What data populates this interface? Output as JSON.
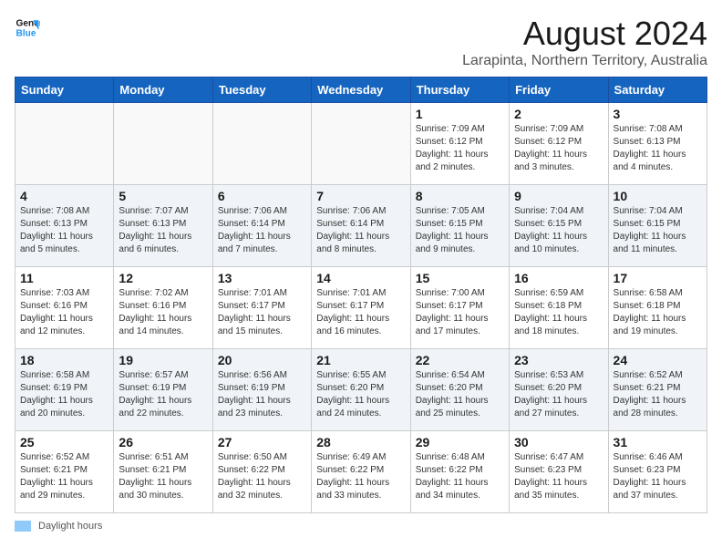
{
  "header": {
    "logo_line1": "General",
    "logo_line2": "Blue",
    "title": "August 2024",
    "subtitle": "Larapinta, Northern Territory, Australia"
  },
  "day_headers": [
    "Sunday",
    "Monday",
    "Tuesday",
    "Wednesday",
    "Thursday",
    "Friday",
    "Saturday"
  ],
  "weeks": [
    [
      {
        "day": "",
        "detail": ""
      },
      {
        "day": "",
        "detail": ""
      },
      {
        "day": "",
        "detail": ""
      },
      {
        "day": "",
        "detail": ""
      },
      {
        "day": "1",
        "detail": "Sunrise: 7:09 AM\nSunset: 6:12 PM\nDaylight: 11 hours\nand 2 minutes."
      },
      {
        "day": "2",
        "detail": "Sunrise: 7:09 AM\nSunset: 6:12 PM\nDaylight: 11 hours\nand 3 minutes."
      },
      {
        "day": "3",
        "detail": "Sunrise: 7:08 AM\nSunset: 6:13 PM\nDaylight: 11 hours\nand 4 minutes."
      }
    ],
    [
      {
        "day": "4",
        "detail": "Sunrise: 7:08 AM\nSunset: 6:13 PM\nDaylight: 11 hours\nand 5 minutes."
      },
      {
        "day": "5",
        "detail": "Sunrise: 7:07 AM\nSunset: 6:13 PM\nDaylight: 11 hours\nand 6 minutes."
      },
      {
        "day": "6",
        "detail": "Sunrise: 7:06 AM\nSunset: 6:14 PM\nDaylight: 11 hours\nand 7 minutes."
      },
      {
        "day": "7",
        "detail": "Sunrise: 7:06 AM\nSunset: 6:14 PM\nDaylight: 11 hours\nand 8 minutes."
      },
      {
        "day": "8",
        "detail": "Sunrise: 7:05 AM\nSunset: 6:15 PM\nDaylight: 11 hours\nand 9 minutes."
      },
      {
        "day": "9",
        "detail": "Sunrise: 7:04 AM\nSunset: 6:15 PM\nDaylight: 11 hours\nand 10 minutes."
      },
      {
        "day": "10",
        "detail": "Sunrise: 7:04 AM\nSunset: 6:15 PM\nDaylight: 11 hours\nand 11 minutes."
      }
    ],
    [
      {
        "day": "11",
        "detail": "Sunrise: 7:03 AM\nSunset: 6:16 PM\nDaylight: 11 hours\nand 12 minutes."
      },
      {
        "day": "12",
        "detail": "Sunrise: 7:02 AM\nSunset: 6:16 PM\nDaylight: 11 hours\nand 14 minutes."
      },
      {
        "day": "13",
        "detail": "Sunrise: 7:01 AM\nSunset: 6:17 PM\nDaylight: 11 hours\nand 15 minutes."
      },
      {
        "day": "14",
        "detail": "Sunrise: 7:01 AM\nSunset: 6:17 PM\nDaylight: 11 hours\nand 16 minutes."
      },
      {
        "day": "15",
        "detail": "Sunrise: 7:00 AM\nSunset: 6:17 PM\nDaylight: 11 hours\nand 17 minutes."
      },
      {
        "day": "16",
        "detail": "Sunrise: 6:59 AM\nSunset: 6:18 PM\nDaylight: 11 hours\nand 18 minutes."
      },
      {
        "day": "17",
        "detail": "Sunrise: 6:58 AM\nSunset: 6:18 PM\nDaylight: 11 hours\nand 19 minutes."
      }
    ],
    [
      {
        "day": "18",
        "detail": "Sunrise: 6:58 AM\nSunset: 6:19 PM\nDaylight: 11 hours\nand 20 minutes."
      },
      {
        "day": "19",
        "detail": "Sunrise: 6:57 AM\nSunset: 6:19 PM\nDaylight: 11 hours\nand 22 minutes."
      },
      {
        "day": "20",
        "detail": "Sunrise: 6:56 AM\nSunset: 6:19 PM\nDaylight: 11 hours\nand 23 minutes."
      },
      {
        "day": "21",
        "detail": "Sunrise: 6:55 AM\nSunset: 6:20 PM\nDaylight: 11 hours\nand 24 minutes."
      },
      {
        "day": "22",
        "detail": "Sunrise: 6:54 AM\nSunset: 6:20 PM\nDaylight: 11 hours\nand 25 minutes."
      },
      {
        "day": "23",
        "detail": "Sunrise: 6:53 AM\nSunset: 6:20 PM\nDaylight: 11 hours\nand 27 minutes."
      },
      {
        "day": "24",
        "detail": "Sunrise: 6:52 AM\nSunset: 6:21 PM\nDaylight: 11 hours\nand 28 minutes."
      }
    ],
    [
      {
        "day": "25",
        "detail": "Sunrise: 6:52 AM\nSunset: 6:21 PM\nDaylight: 11 hours\nand 29 minutes."
      },
      {
        "day": "26",
        "detail": "Sunrise: 6:51 AM\nSunset: 6:21 PM\nDaylight: 11 hours\nand 30 minutes."
      },
      {
        "day": "27",
        "detail": "Sunrise: 6:50 AM\nSunset: 6:22 PM\nDaylight: 11 hours\nand 32 minutes."
      },
      {
        "day": "28",
        "detail": "Sunrise: 6:49 AM\nSunset: 6:22 PM\nDaylight: 11 hours\nand 33 minutes."
      },
      {
        "day": "29",
        "detail": "Sunrise: 6:48 AM\nSunset: 6:22 PM\nDaylight: 11 hours\nand 34 minutes."
      },
      {
        "day": "30",
        "detail": "Sunrise: 6:47 AM\nSunset: 6:23 PM\nDaylight: 11 hours\nand 35 minutes."
      },
      {
        "day": "31",
        "detail": "Sunrise: 6:46 AM\nSunset: 6:23 PM\nDaylight: 11 hours\nand 37 minutes."
      }
    ]
  ],
  "footer": {
    "swatch_label": "Daylight hours"
  }
}
